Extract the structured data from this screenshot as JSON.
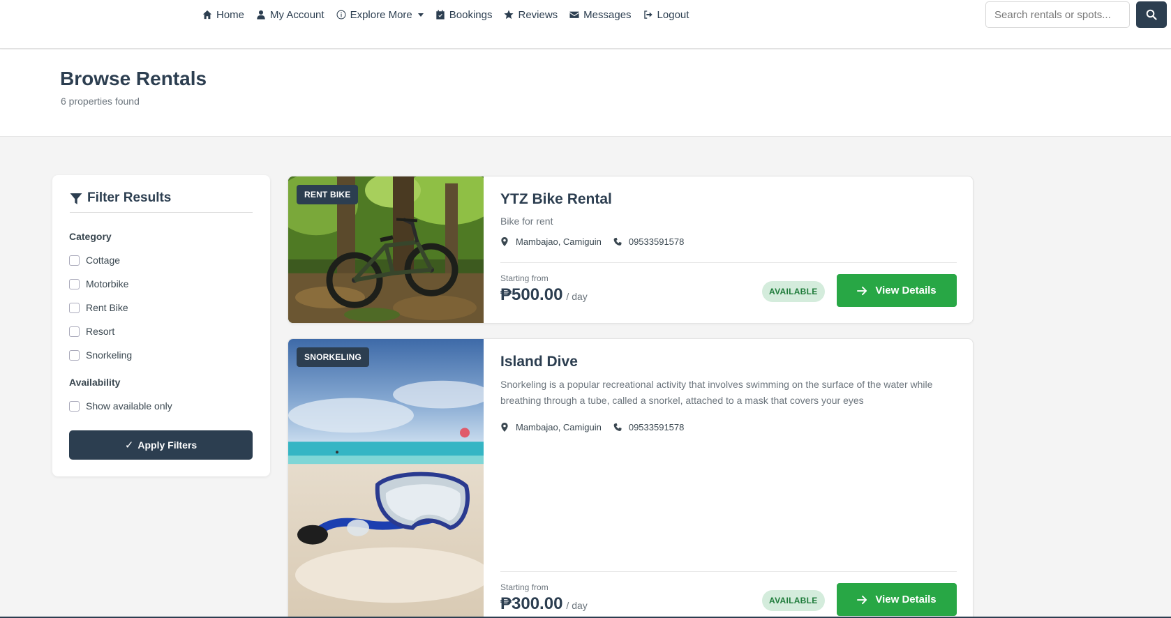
{
  "nav": {
    "items": [
      {
        "label": "Home",
        "icon": "home-icon"
      },
      {
        "label": "My Account",
        "icon": "user-icon"
      },
      {
        "label": "Explore More",
        "icon": "info-icon"
      },
      {
        "label": "Bookings",
        "icon": "calendar-check-icon"
      },
      {
        "label": "Reviews",
        "icon": "star-icon"
      },
      {
        "label": "Messages",
        "icon": "envelope-icon"
      },
      {
        "label": "Logout",
        "icon": "logout-icon"
      }
    ],
    "search_placeholder": "Search rentals or spots..."
  },
  "header": {
    "title": "Browse Rentals",
    "count": "6 properties found"
  },
  "filters": {
    "title": "Filter Results",
    "category_label": "Category",
    "categories": [
      "Cottage",
      "Motorbike",
      "Rent Bike",
      "Resort",
      "Snorkeling"
    ],
    "availability_label": "Availability",
    "availability_option": "Show available only",
    "apply_label": "Apply Filters"
  },
  "listings": [
    {
      "badge": "RENT BIKE",
      "title": "YTZ Bike Rental",
      "description": "Bike for rent",
      "location": "Mambajao, Camiguin",
      "phone": "09533591578",
      "starting_label": "Starting from",
      "price": "₱500.00",
      "unit": "/ day",
      "status": "AVAILABLE",
      "button": "View Details"
    },
    {
      "badge": "SNORKELING",
      "title": "Island Dive",
      "description": "Snorkeling is a popular recreational activity that involves swimming on the surface of the water while breathing through a tube, called a snorkel, attached to a mask that covers your eyes",
      "location": "Mambajao, Camiguin",
      "phone": "09533591578",
      "starting_label": "Starting from",
      "price": "₱300.00",
      "unit": "/ day",
      "status": "AVAILABLE",
      "button": "View Details"
    }
  ],
  "colors": {
    "primary": "#2c3e50",
    "success": "#28a745",
    "available_bg": "#d4ecdc"
  }
}
